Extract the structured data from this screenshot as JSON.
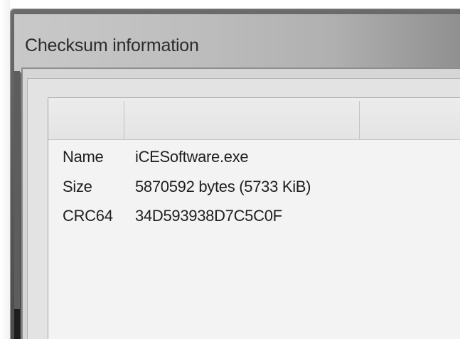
{
  "window": {
    "title": "Checksum information"
  },
  "info": {
    "rows": [
      {
        "label": "Name",
        "value": "iCESoftware.exe"
      },
      {
        "label": "Size",
        "value": "5870592 bytes (5733 KiB)"
      },
      {
        "label": "CRC64",
        "value": "34D593938D7C5C0F"
      }
    ]
  },
  "colors": {
    "frame": "#4a4a4a",
    "titlebar": "#c0c0c0",
    "client": "#f3f3f3",
    "text": "#1f1f1f"
  }
}
